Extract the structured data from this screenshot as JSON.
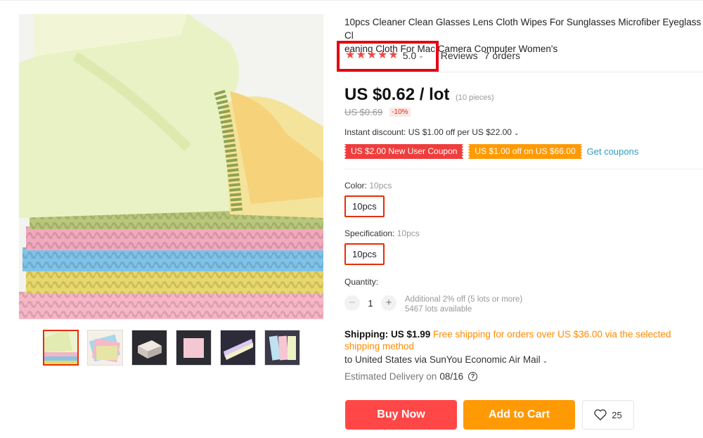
{
  "product": {
    "title": "10pcs Cleaner Clean Glasses Lens Cloth Wipes For Sunglasses Microfiber Eyeglass Cl\neaning Cloth For Mac Camera Computer Women's",
    "rating": {
      "stars": 5,
      "value": "5.0",
      "reviews_label": "Reviews",
      "orders": "7 orders"
    },
    "price": {
      "current": "US $0.62 / lot",
      "pieces_note": "(10 pieces)",
      "original": "US $0.69",
      "discount": "-10%"
    },
    "instant_discount": "Instant discount: US $1.00 off per US $22.00",
    "coupons": [
      {
        "label": "US $2.00 New User Coupon",
        "color": "#ef3d3d"
      },
      {
        "label": "US $1.00 off on US $66.00",
        "color": "#ff9a05"
      }
    ],
    "get_coupons_label": "Get coupons",
    "color": {
      "label": "Color:",
      "selected": "10pcs",
      "option": "10pcs"
    },
    "specification": {
      "label": "Specification:",
      "selected": "10pcs",
      "option": "10pcs"
    },
    "quantity": {
      "label": "Quantity:",
      "value": "1",
      "minus": "−",
      "plus": "+",
      "bulk_note": "Additional 2% off (5 lots or more)",
      "available": "5467 lots available"
    },
    "shipping": {
      "cost": "Shipping: US $1.99",
      "free_note": "Free shipping for orders over US $36.00 via the selected shipping method",
      "destination": "to United States via SunYou Economic Air Mail",
      "estimated_label": "Estimated Delivery on",
      "estimated_date": "08/16"
    },
    "actions": {
      "buy_now": "Buy Now",
      "add_to_cart": "Add to Cart",
      "wishlist_count": "25"
    },
    "thumbnails_count": 6,
    "accent_color": "#e62e04"
  }
}
